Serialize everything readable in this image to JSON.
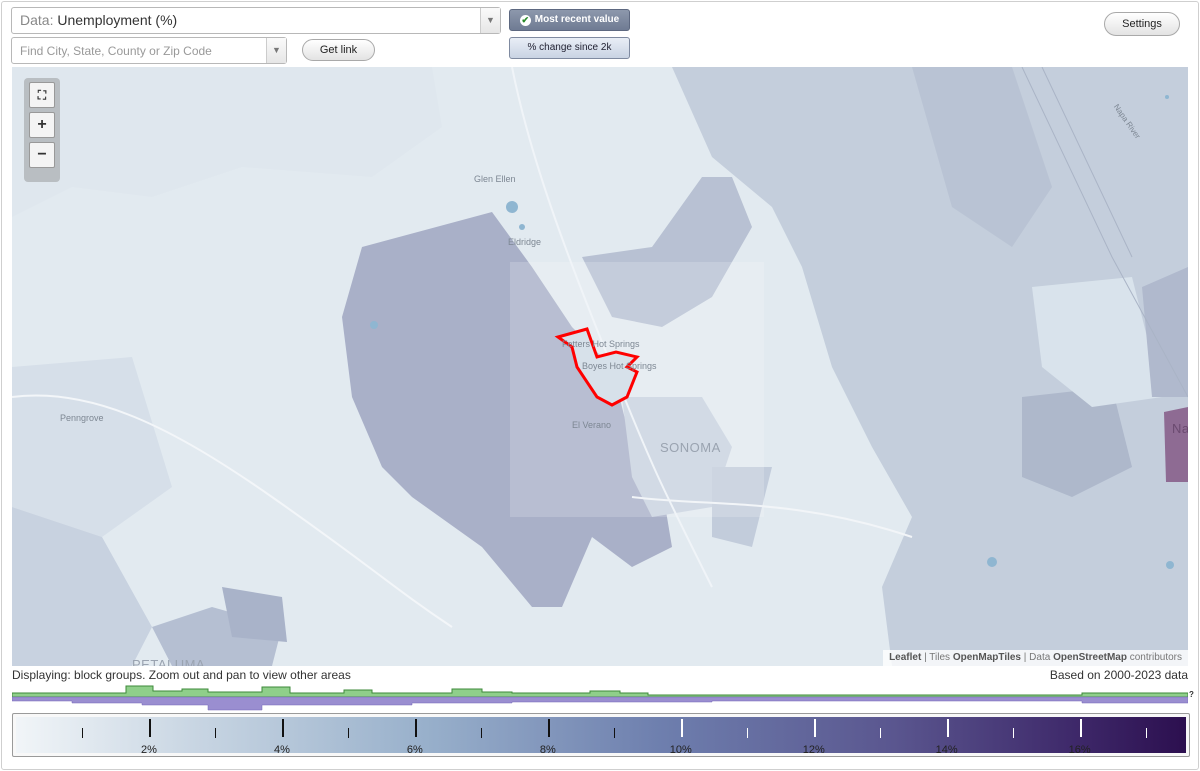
{
  "header": {
    "data_prefix": "Data:",
    "data_value": "Unemployment (%)",
    "search_placeholder": "Find City, State, County or Zip Code",
    "get_link": "Get link",
    "toggle_recent": "Most recent value",
    "toggle_change": "% change since 2k",
    "settings": "Settings"
  },
  "map": {
    "places": {
      "glen_ellen": "Glen Ellen",
      "eldridge": "Eldridge",
      "fetters": "Fetters Hot Springs",
      "boyes": "Boyes Hot Springs",
      "el_verano": "El Verano",
      "sonoma": "SONOMA",
      "penngrove": "Penngrove",
      "petaluma": "PETALUMA",
      "napa_river": "Napa River",
      "napa": "Na"
    },
    "zoom": {
      "fit": "⛶",
      "in": "+",
      "out": "−"
    },
    "attribution": {
      "leaflet": "Leaflet",
      "tiles": "Tiles",
      "openmaptiles": "OpenMapTiles",
      "data": "Data",
      "osm": "OpenStreetMap",
      "contributors": "contributors"
    },
    "colors": {
      "highlight": "#ff0000",
      "region_dark": "#a9b0c8",
      "region_mid": "#bfc9d8",
      "region_light": "#d6e0ea",
      "water": "#7fb0d0"
    }
  },
  "status": {
    "left": "Displaying: block groups. Zoom out and pan to view other areas",
    "right": "Based on 2000-2023 data",
    "hist_help": "?"
  },
  "legend": {
    "ticks": [
      "2%",
      "4%",
      "6%",
      "8%",
      "10%",
      "12%",
      "14%",
      "16%"
    ],
    "tick_values": [
      2,
      4,
      6,
      8,
      10,
      12,
      14,
      16
    ],
    "range": [
      0,
      17.6
    ]
  }
}
